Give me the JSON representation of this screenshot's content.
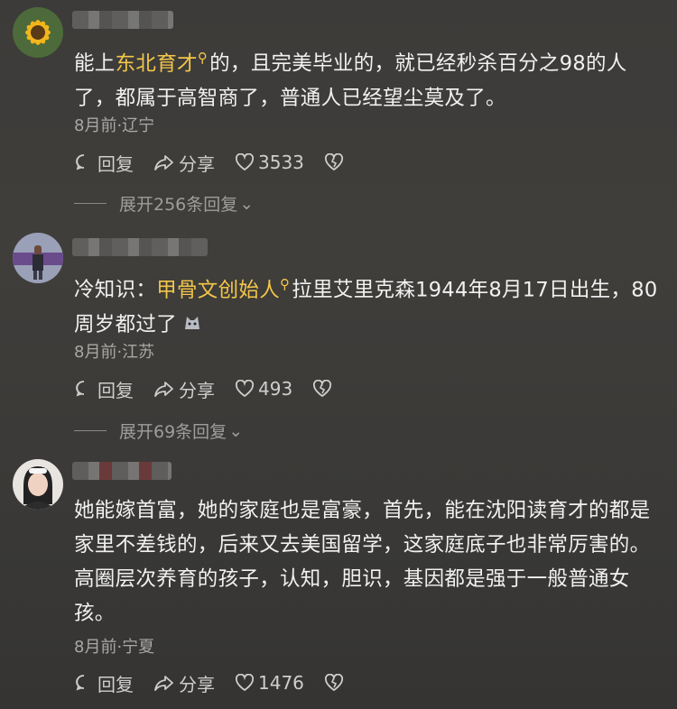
{
  "comments": [
    {
      "text_before": "能上",
      "link": "东北育才",
      "text_after": "的，且完美毕业的，就已经秒杀百分之98的人了，都属于高智商了，普通人已经望尘莫及了。",
      "meta": "8月前·辽宁",
      "reply": "回复",
      "share": "分享",
      "likes": "3533",
      "expand": "展开256条回复"
    },
    {
      "text_before": "冷知识：",
      "link": "甲骨文创始人",
      "text_after": "拉里艾里克森1944年8月17日出生，80周岁都过了",
      "meta": "8月前·江苏",
      "reply": "回复",
      "share": "分享",
      "likes": "493",
      "expand": "展开69条回复"
    },
    {
      "text_before": "她能嫁首富，她的家庭也是富豪，首先，能在沈阳读育才的都是家里不差钱的，后来又去美国留学，这家庭底子也非常厉害的。高圈层次养育的孩子，认知，胆识，基因都是强于一般普通女孩。",
      "link": "",
      "text_after": "",
      "meta": "8月前·宁夏",
      "reply": "回复",
      "share": "分享",
      "likes": "1476",
      "expand": ""
    }
  ]
}
